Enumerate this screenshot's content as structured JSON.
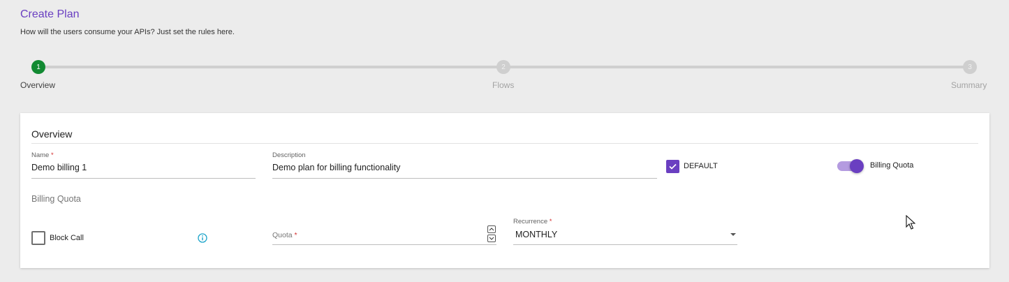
{
  "header": {
    "title": "Create Plan",
    "subtitle": "How will the users consume your APIs? Just set the rules here."
  },
  "stepper": {
    "steps": [
      {
        "number": "1",
        "label": "Overview",
        "state": "active"
      },
      {
        "number": "2",
        "label": "Flows",
        "state": "inactive"
      },
      {
        "number": "3",
        "label": "Summary",
        "state": "inactive"
      }
    ]
  },
  "overview": {
    "section_title": "Overview",
    "name": {
      "label": "Name",
      "required_mark": "*",
      "value": "Demo billing 1"
    },
    "description": {
      "label": "Description",
      "value": "Demo plan for billing functionality"
    },
    "default_checkbox": {
      "label": "DEFAULT",
      "checked": true
    },
    "billing_quota_toggle": {
      "label": "Billing Quota",
      "on": true
    }
  },
  "billing_quota": {
    "section_title": "Billing Quota",
    "block_call": {
      "label": "Block Call",
      "checked": false
    },
    "info_icon": "info-icon",
    "quota": {
      "placeholder": "Quota",
      "required_mark": "*",
      "value": ""
    },
    "recurrence": {
      "label": "Recurrence",
      "required_mark": "*",
      "value": "MONTHLY"
    }
  },
  "colors": {
    "accent": "#6a3fc1",
    "step_active": "#128a32",
    "info_icon": "#1aa3c9"
  }
}
